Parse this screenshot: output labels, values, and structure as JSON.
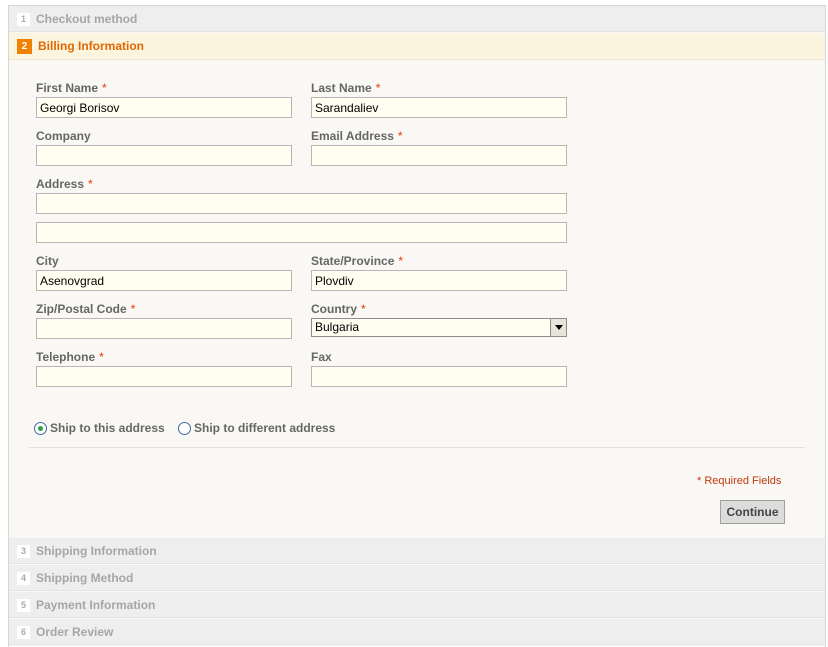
{
  "steps": [
    {
      "num": "1",
      "title": "Checkout method"
    },
    {
      "num": "2",
      "title": "Billing Information"
    },
    {
      "num": "3",
      "title": "Shipping Information"
    },
    {
      "num": "4",
      "title": "Shipping Method"
    },
    {
      "num": "5",
      "title": "Payment Information"
    },
    {
      "num": "6",
      "title": "Order Review"
    }
  ],
  "form": {
    "required_mark": "*",
    "first_name": {
      "label": "First Name",
      "value": "Georgi Borisov"
    },
    "last_name": {
      "label": "Last Name",
      "value": "Sarandaliev"
    },
    "company": {
      "label": "Company",
      "value": ""
    },
    "email": {
      "label": "Email Address",
      "value": ""
    },
    "address": {
      "label": "Address",
      "value1": "",
      "value2": ""
    },
    "city": {
      "label": "City",
      "value": "Asenovgrad"
    },
    "state": {
      "label": "State/Province",
      "value": "Plovdiv"
    },
    "zip": {
      "label": "Zip/Postal Code",
      "value": ""
    },
    "country": {
      "label": "Country",
      "value": "Bulgaria"
    },
    "telephone": {
      "label": "Telephone",
      "value": ""
    },
    "fax": {
      "label": "Fax",
      "value": ""
    },
    "ship_same": "Ship to this address",
    "ship_diff": "Ship to different address",
    "required_note": "* Required Fields",
    "continue_label": "Continue"
  },
  "colors": {
    "accent": "#e26703",
    "required": "#eb340a",
    "field_bg": "#fffef0"
  }
}
